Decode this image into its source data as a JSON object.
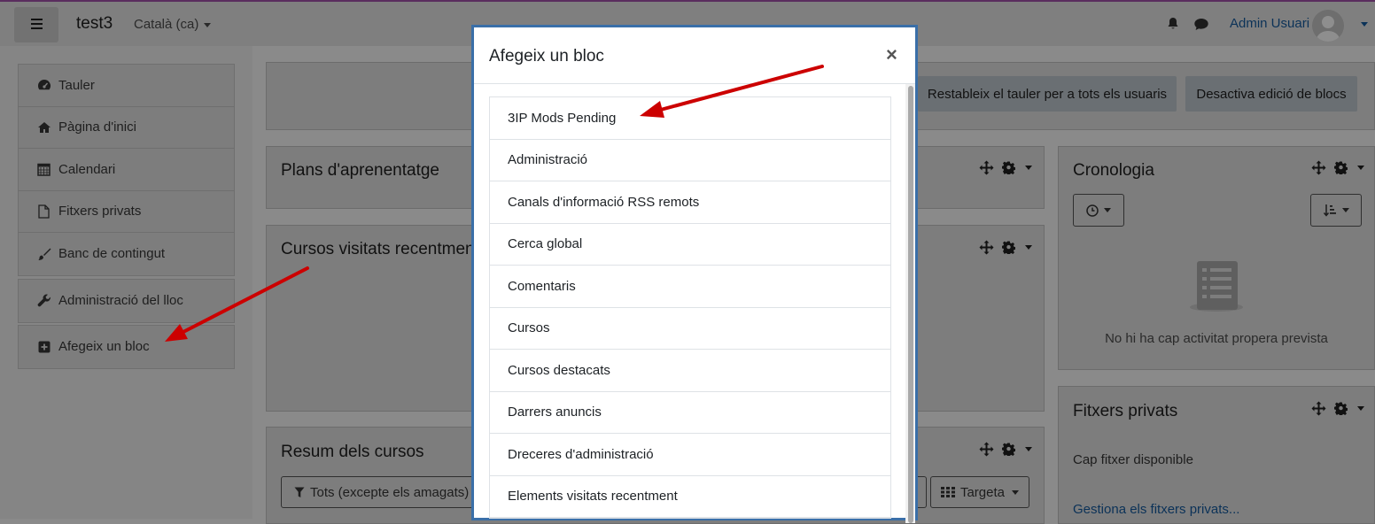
{
  "navbar": {
    "site_name": "test3",
    "language": "Català (ca)",
    "user_name": "Admin Usuari"
  },
  "drawer": {
    "items": [
      {
        "label": "Tauler",
        "icon": "dashboard-icon"
      },
      {
        "label": "Pàgina d'inici",
        "icon": "home-icon"
      },
      {
        "label": "Calendari",
        "icon": "calendar-icon"
      },
      {
        "label": "Fitxers privats",
        "icon": "file-icon"
      },
      {
        "label": "Banc de contingut",
        "icon": "brush-icon"
      }
    ],
    "admin_item": {
      "label": "Administració del lloc",
      "icon": "wrench-icon"
    },
    "add_block_item": {
      "label": "Afegeix un bloc",
      "icon": "plus-square-icon"
    }
  },
  "header_buttons": {
    "reset_dashboard": "Restableix el tauler per a tots els usuaris",
    "stop_editing": "Desactiva edició de blocs"
  },
  "blocks": {
    "learning_plans": {
      "title": "Plans d'aprenentatge"
    },
    "recent_courses": {
      "title": "Cursos visitats recentment"
    },
    "course_overview": {
      "title": "Resum dels cursos",
      "filter_label": "Tots (excepte els amagats)",
      "view_label": "Targeta"
    },
    "timeline": {
      "title": "Cronologia",
      "empty_text": "No hi ha cap activitat propera prevista"
    },
    "private_files": {
      "title": "Fitxers privats",
      "empty_text": "Cap fitxer disponible",
      "manage_link": "Gestiona els fitxers privats..."
    }
  },
  "modal": {
    "title": "Afegeix un bloc",
    "close_label": "×",
    "items": [
      "3IP Mods Pending",
      "Administració",
      "Canals d'informació RSS remots",
      "Cerca global",
      "Comentaris",
      "Cursos",
      "Cursos destacats",
      "Darrers anuncis",
      "Dreceres d'administració",
      "Elements visitats recentment"
    ]
  },
  "colors": {
    "annotation_arrow": "#cc0000",
    "modal_border": "#3a6fa8",
    "link": "#0b3258",
    "navbar_accent": "#5a2d5e"
  }
}
